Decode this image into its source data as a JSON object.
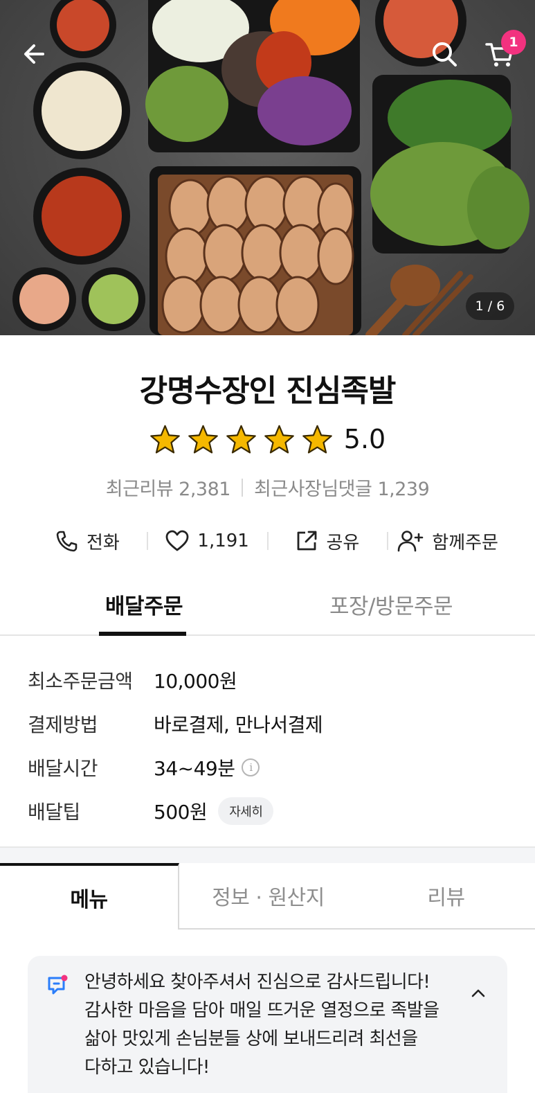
{
  "hero": {
    "photo_counter": "1 / 6",
    "cart_count": "1"
  },
  "store": {
    "name": "강명수장인 진심족발",
    "rating": "5.0",
    "stars": 5,
    "recent_reviews": "최근리뷰 2,381",
    "owner_replies": "최근사장님댓글 1,239"
  },
  "actions": {
    "call": "전화",
    "likes": "1,191",
    "share": "공유",
    "group_order": "함께주문"
  },
  "order_tabs": {
    "delivery": "배달주문",
    "pickup": "포장/방문주문"
  },
  "delivery_info": {
    "min_order_label": "최소주문금액",
    "min_order_value": "10,000원",
    "payment_label": "결제방법",
    "payment_value": "바로결제, 만나서결제",
    "time_label": "배달시간",
    "time_value": "34~49분",
    "tip_label": "배달팁",
    "tip_value": "500원",
    "tip_detail_button": "자세히"
  },
  "menu_tabs": {
    "menu": "메뉴",
    "info": "정보 · 원산지",
    "reviews": "리뷰"
  },
  "notice": {
    "text": "안녕하세요 찾아주셔서 진심으로 감사드립니다!\n감사한 마음을 담아 매일 뜨거운 열정으로 족발을\n삶아 맛있게 손님분들 상에 보내드리려 최선을\n다하고 있습니다!"
  },
  "colors": {
    "badge": "#f2327f",
    "star": "#f5b800",
    "notice_icon": "#2a7dfa"
  }
}
